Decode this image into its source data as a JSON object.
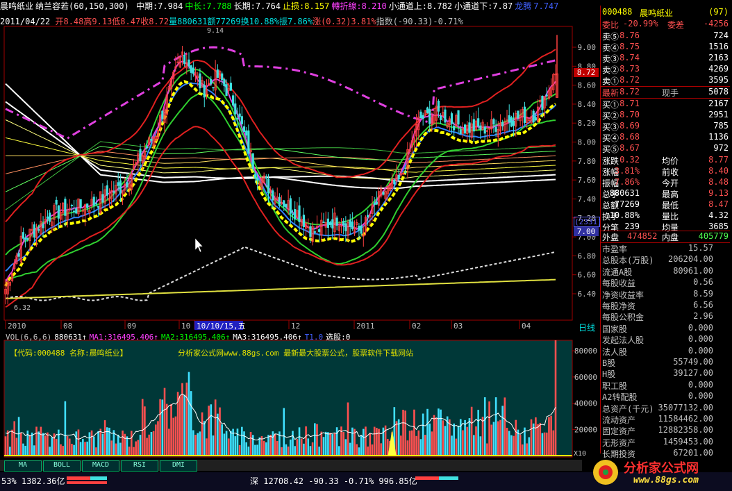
{
  "header": {
    "stock_name": "晨鸣纸业",
    "indicator": "纳兰容若(60,150,300)",
    "items": [
      {
        "label": "中期:7.984",
        "color": "#ffffff"
      },
      {
        "label": "中长:7.788",
        "color": "#00ff00"
      },
      {
        "label": "长期:7.764",
        "color": "#ffffff"
      },
      {
        "label": "止损:8.157",
        "color": "#ffff00"
      },
      {
        "label": "轉折線:8.210",
        "color": "#ff40ff"
      },
      {
        "label": "小通道上:8.782",
        "color": "#ffffff"
      },
      {
        "label": "小通道下:7.87",
        "color": "#ffffff"
      },
      {
        "label": "龙腾",
        "color": "#4060ff"
      },
      {
        "label": "7.747",
        "color": "#4060ff"
      }
    ],
    "date": "2011/04/22",
    "ohlc": [
      {
        "label": "开8.48",
        "color": "#ff5050"
      },
      {
        "label": "高9.13",
        "color": "#ff5050"
      },
      {
        "label": "低8.47",
        "color": "#ff5050"
      },
      {
        "label": "收8.72",
        "color": "#ff5050"
      },
      {
        "label": "量880631",
        "color": "#00e0e0"
      },
      {
        "label": "额77269",
        "color": "#00e0e0"
      },
      {
        "label": "换10.88%",
        "color": "#00e0e0"
      },
      {
        "label": "振7.86%",
        "color": "#00e0e0"
      },
      {
        "label": "涨(0.32)3.81%",
        "color": "#ff5050"
      },
      {
        "label": "指数(-90.33)-0.71%",
        "color": "#c0c0c0"
      }
    ]
  },
  "chart_data": [
    {
      "type": "candlestick",
      "yticks": [
        "9.00",
        "8.80",
        "8.60",
        "8.40",
        "8.20",
        "8.00",
        "7.80",
        "7.60",
        "7.40",
        "7.20",
        "7.00",
        "6.80",
        "6.60",
        "6.40"
      ],
      "ylim": [
        6.3,
        9.25
      ],
      "xticks": [
        "2010",
        "08",
        "09",
        "10",
        "10/10/15,五",
        "12",
        "2011",
        "02",
        "03",
        "04"
      ],
      "annotations": [
        "9.14",
        "6.32",
        "8.72",
        "(2331)",
        "7.00"
      ],
      "last_price": "8.72"
    },
    {
      "type": "bar",
      "title_items": [
        {
          "label": "VOL(6,6,6)",
          "color": "#c0c0c0"
        },
        {
          "label": "880631↑",
          "color": "#ffffff"
        },
        {
          "label": "MA1:316495.406↑",
          "color": "#ff40ff"
        },
        {
          "label": "MA2:316495.406↑",
          "color": "#00ff00"
        },
        {
          "label": "MA3:316495.406↑",
          "color": "#ffffff"
        },
        {
          "label": "T1.0",
          "color": "#4060ff"
        },
        {
          "label": "选股:0",
          "color": "#ffffff"
        }
      ],
      "yticks": [
        "80000",
        "60000",
        "40000",
        "20000"
      ],
      "ylim": [
        0,
        88000
      ],
      "unit": "X10",
      "overlay_text": "【代码:000488 名称:晨鸣纸业】",
      "banner": "分析家公式网www.88gs.com 最新最大股票公式，股票软件下载网站"
    }
  ],
  "right_panel": {
    "code": "000488",
    "name": "晨鸣纸业",
    "count": "(97)",
    "weibi_label": "委比",
    "weibi": "-20.99%",
    "weicha_label": "委差",
    "weicha": "-4256",
    "sell": [
      {
        "label": "卖⑤",
        "price": "8.76",
        "vol": "724"
      },
      {
        "label": "卖④",
        "price": "8.75",
        "vol": "1516"
      },
      {
        "label": "卖③",
        "price": "8.74",
        "vol": "2163"
      },
      {
        "label": "卖②",
        "price": "8.73",
        "vol": "4269"
      },
      {
        "label": "卖①",
        "price": "8.72",
        "vol": "3595"
      }
    ],
    "last_label": "最新",
    "last": "8.72",
    "hand_label": "现手",
    "hand": "5078",
    "buy": [
      {
        "label": "买①",
        "price": "8.71",
        "vol": "2167"
      },
      {
        "label": "买②",
        "price": "8.70",
        "vol": "2951"
      },
      {
        "label": "买③",
        "price": "8.69",
        "vol": "785"
      },
      {
        "label": "买④",
        "price": "8.68",
        "vol": "1136"
      },
      {
        "label": "买⑤",
        "price": "8.67",
        "vol": "972"
      }
    ],
    "stats": [
      {
        "l": "涨跌",
        "v": "0.32",
        "m": "均价",
        "v2": "8.77"
      },
      {
        "l": "涨幅",
        "v": "3.81%",
        "m": "前收",
        "v2": "8.40"
      },
      {
        "l": "振幅",
        "v": "7.86%",
        "m": "今开",
        "v2": "8.48"
      },
      {
        "l": "总手",
        "v": "880631",
        "m": "最高",
        "v2": "9.13"
      },
      {
        "l": "总额",
        "v": "77269",
        "m": "最低",
        "v2": "8.47"
      },
      {
        "l": "换手",
        "v": "10.88%",
        "m": "量比",
        "v2": "4.32"
      },
      {
        "l": "分笔",
        "v": "239",
        "m": "均量",
        "v2": "3685"
      }
    ],
    "outer_label": "外盘",
    "outer": "474852",
    "inner_label": "内盘",
    "inner": "405779",
    "fundamentals": [
      {
        "l": "市盈率",
        "v": "15.57"
      },
      {
        "l": "总股本(万股)",
        "v": "206204.00"
      },
      {
        "l": "流通A股",
        "v": "80961.00"
      },
      {
        "l": "每股收益",
        "v": "0.56"
      },
      {
        "l": "净资收益率",
        "v": "8.59"
      },
      {
        "l": "每股净资",
        "v": "6.56"
      },
      {
        "l": "每股公积金",
        "v": "2.96"
      },
      {
        "l": "国家股",
        "v": "0.000"
      },
      {
        "l": "发起法人股",
        "v": "0.000"
      },
      {
        "l": "法人股",
        "v": "0.000"
      },
      {
        "l": "B股",
        "v": "55749.00"
      },
      {
        "l": "H股",
        "v": "39127.00"
      },
      {
        "l": "职工股",
        "v": "0.000"
      },
      {
        "l": "A2转配股",
        "v": "0.000"
      },
      {
        "l": "总资产(千元)",
        "v": "35077132.00"
      },
      {
        "l": "流动资产",
        "v": "11584462.00"
      },
      {
        "l": "固定资产",
        "v": "12882358.00"
      },
      {
        "l": "无形资产",
        "v": "1459453.00"
      },
      {
        "l": "长期投资",
        "v": "67201.00"
      }
    ]
  },
  "tabs": [
    "MA",
    "BOLL",
    "MACD",
    "RSI",
    "DMI"
  ],
  "period_label": "日线",
  "status": {
    "left": "53% 1382.36亿",
    "index": "深 12708.42 -90.33 -0.71% 996.85亿"
  },
  "logo": {
    "text": "分析家公式网",
    "url": "www.88gs.com"
  }
}
